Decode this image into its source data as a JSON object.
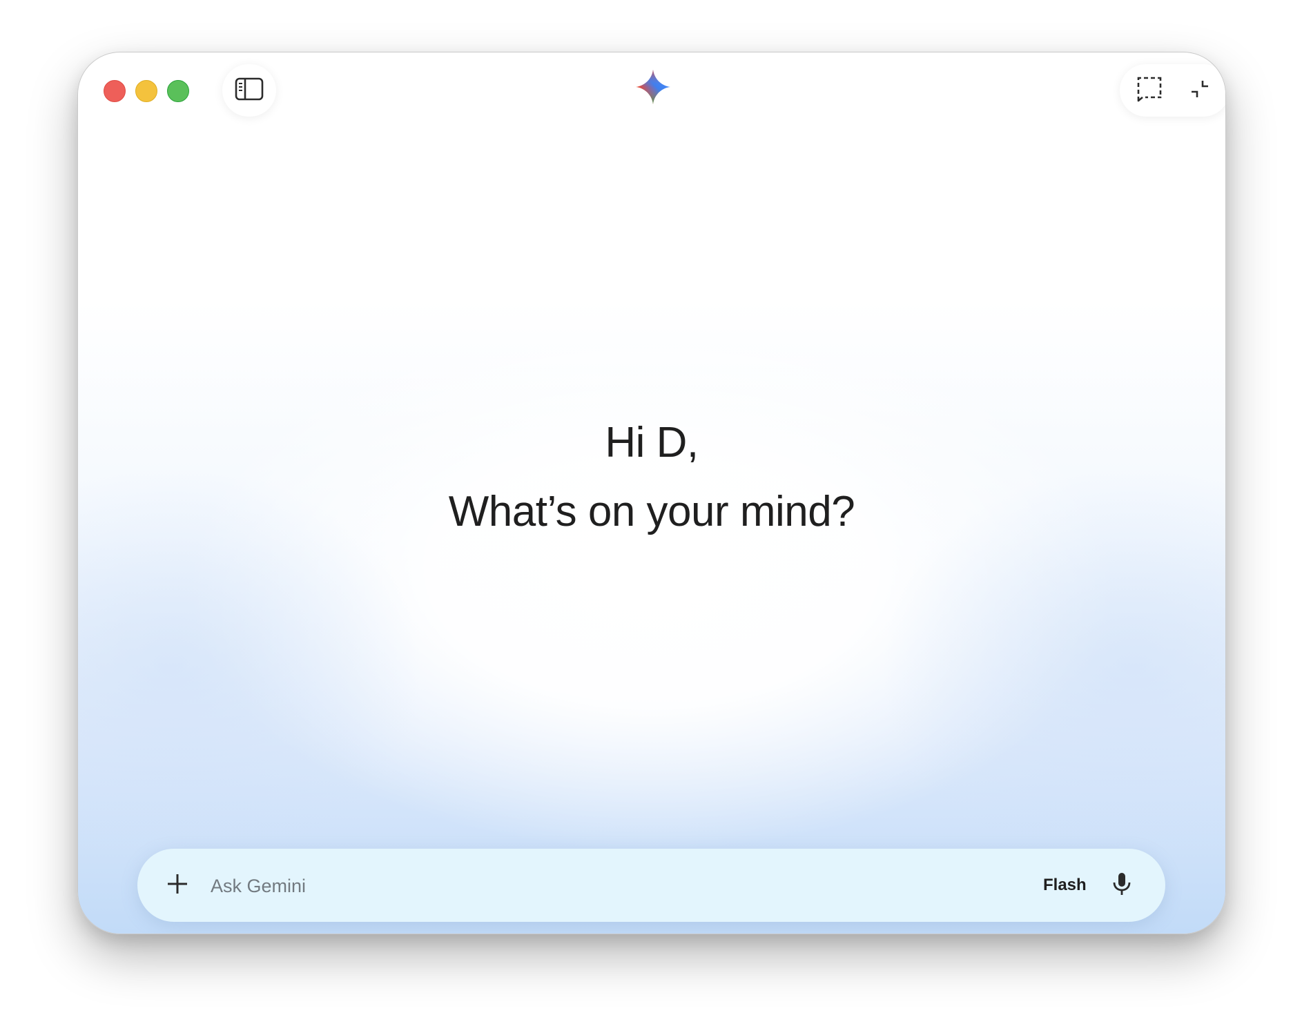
{
  "window": {
    "traffic_lights": {
      "close_color": "#ee5f59",
      "minimize_color": "#f4c23d",
      "maximize_color": "#5ac05a"
    }
  },
  "toolbar": {
    "sidebar_icon": "sidebar-toggle-icon",
    "logo_icon": "gemini-sparkle-icon",
    "right_icons": [
      "screenshot-region-icon",
      "collapse-icon"
    ]
  },
  "main": {
    "greeting_line1": "Hi D,",
    "greeting_line2": "What’s on your mind?"
  },
  "composer": {
    "placeholder": "Ask Gemini",
    "value": "",
    "add_icon": "plus-icon",
    "model_label": "Flash",
    "mic_icon": "microphone-icon",
    "background": "#e3f5fd"
  }
}
